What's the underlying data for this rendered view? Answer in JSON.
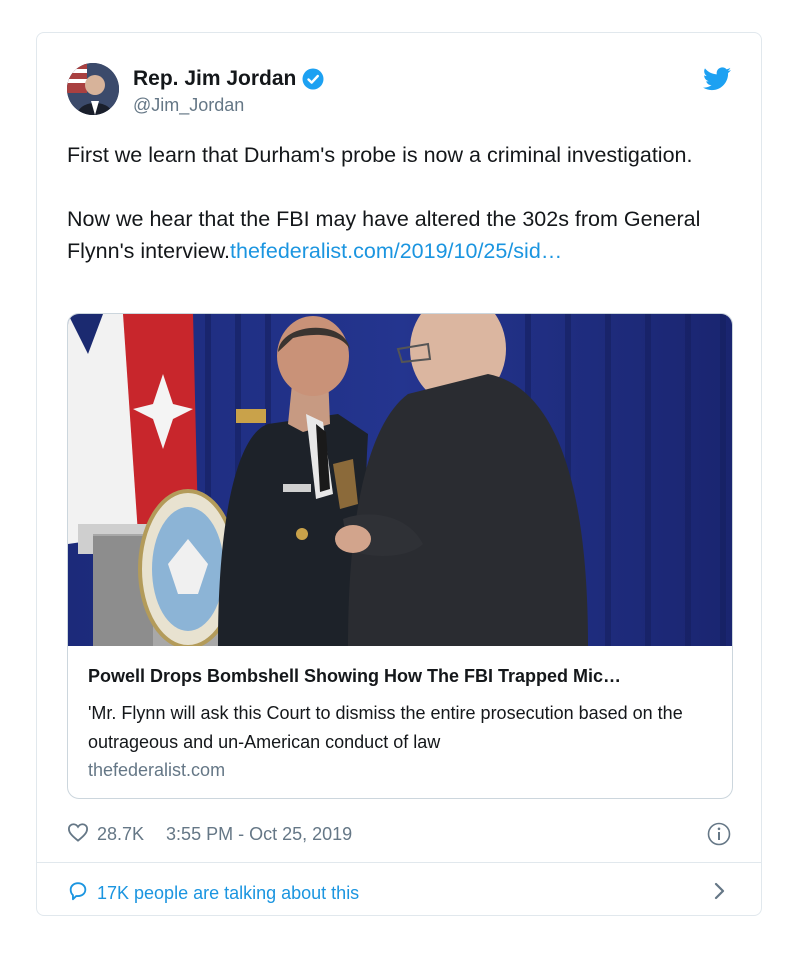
{
  "author": {
    "name": "Rep. Jim Jordan",
    "handle": "@Jim_Jordan"
  },
  "tweet": {
    "paragraph1": "First we learn that Durham's probe is now a criminal investigation.",
    "paragraph2_text": "Now we hear that the FBI may have altered the 302s from General Flynn's interview.",
    "paragraph2_link": "thefederalist.com/2019/10/25/sid…"
  },
  "preview": {
    "title": "Powell Drops Bombshell Showing How The FBI Trapped Mic…",
    "description": "'Mr. Flynn will ask this Court to dismiss the entire prosecution based on the outrageous and un-American conduct of law",
    "domain": "thefederalist.com"
  },
  "footer": {
    "likes": "28.7K",
    "timestamp": "3:55 PM - Oct 25, 2019",
    "talking": "17K people are talking about this"
  },
  "icons": {
    "verified": "verified-badge-icon",
    "bird": "twitter-bird-icon",
    "heart": "heart-icon",
    "info": "info-icon",
    "speech": "speech-bubble-icon",
    "chevron": "chevron-right-icon"
  },
  "colors": {
    "accent": "#1b95e0",
    "secondary_text": "#657786",
    "border": "#e1e8ed"
  }
}
